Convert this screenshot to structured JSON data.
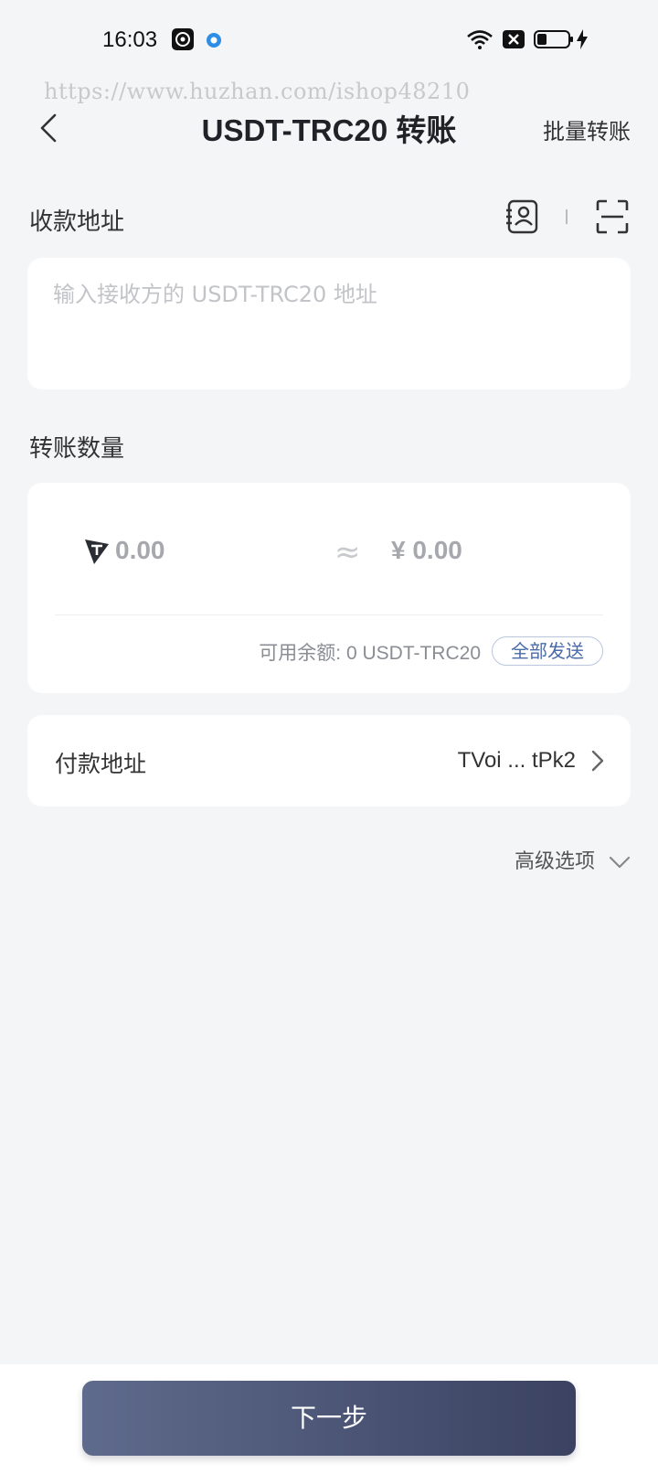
{
  "status_bar": {
    "time": "16:03",
    "icons": [
      "music-app-icon",
      "browser-app-icon",
      "wifi-icon",
      "sim-blocked-icon",
      "battery-icon",
      "charging-icon"
    ]
  },
  "watermark": "https://www.huzhan.com/ishop48210",
  "nav": {
    "title": "USDT-TRC20 转账",
    "right_label": "批量转账"
  },
  "receive": {
    "label": "收款地址",
    "placeholder": "输入接收方的 USDT-TRC20 地址",
    "value": ""
  },
  "amount": {
    "label": "转账数量",
    "token_value": "0.00",
    "approx_symbol": "≈",
    "fiat_value": "¥ 0.00",
    "balance_text": "可用余额: 0 USDT-TRC20",
    "send_all_label": "全部发送"
  },
  "payment": {
    "label": "付款地址",
    "address": "TVoi ... tPk2"
  },
  "advanced_label": "高级选项",
  "next_label": "下一步",
  "colors": {
    "background": "#f4f5f7",
    "card": "#ffffff",
    "accent": "#4a6aa8",
    "button_start": "#5f6b8c",
    "button_end": "#3b4262"
  }
}
